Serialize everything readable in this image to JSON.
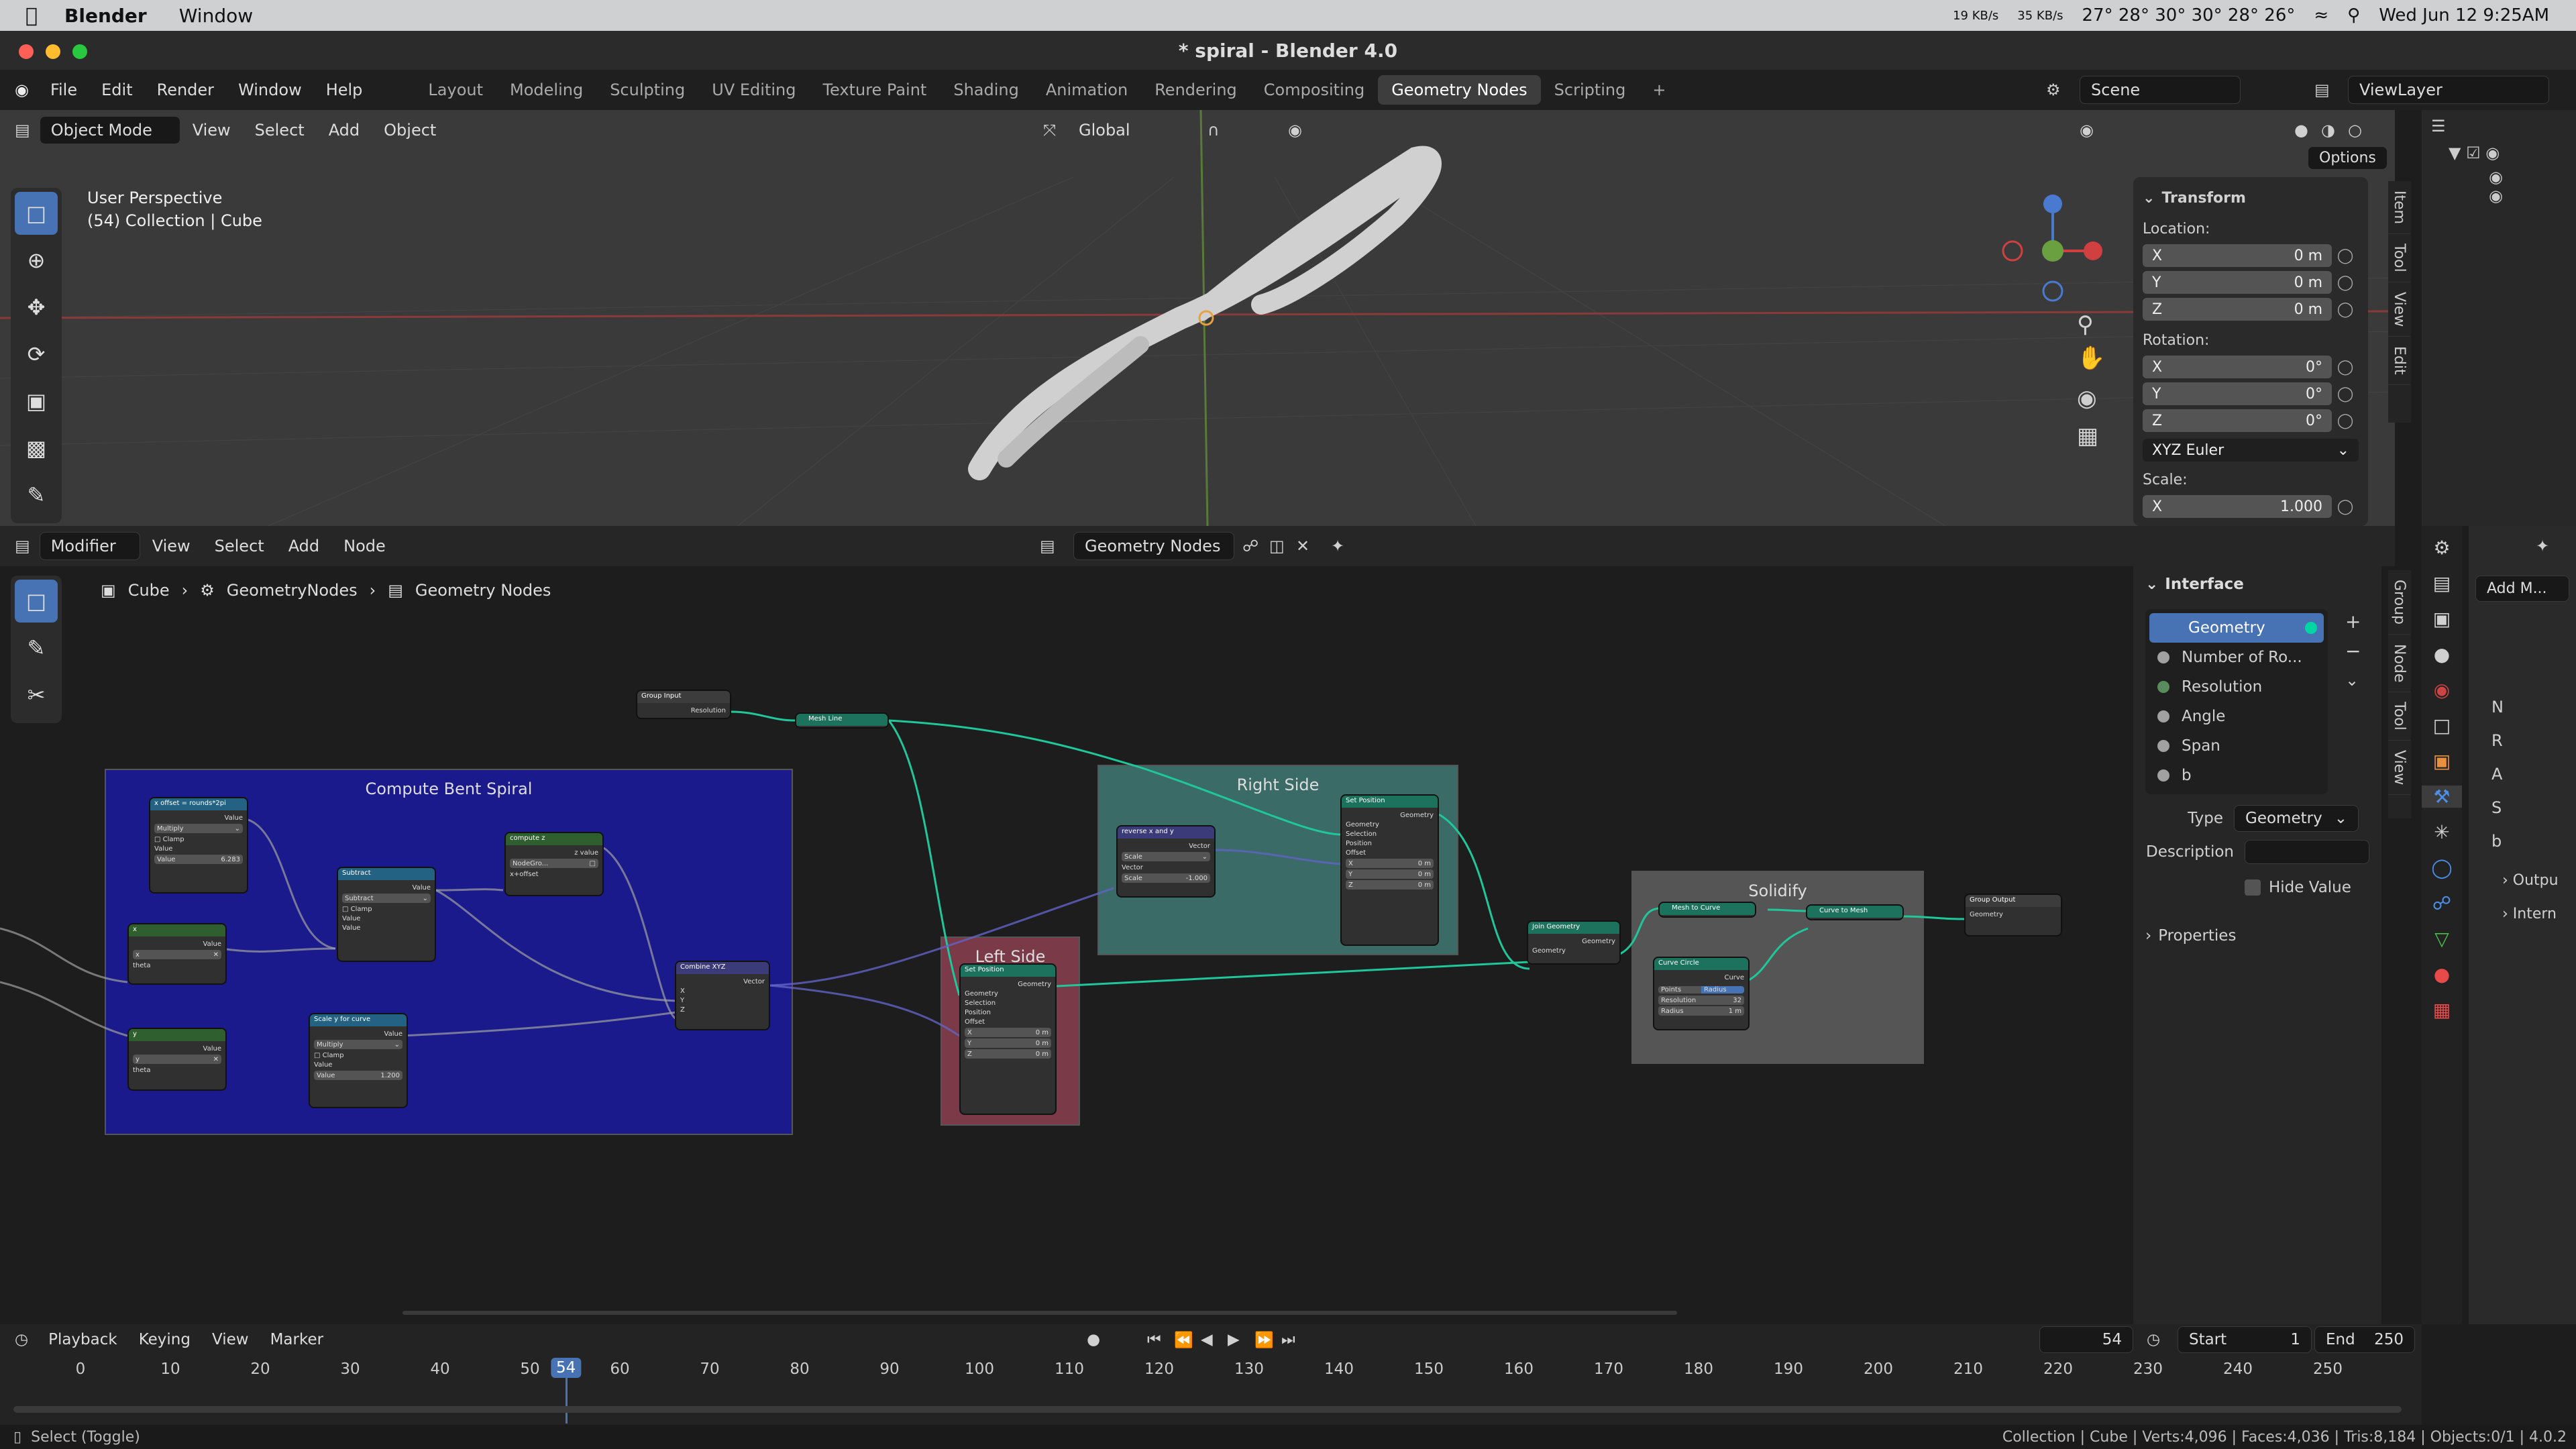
{
  "mac": {
    "app": "Blender",
    "menu": [
      "Window"
    ],
    "net_up": "19 KB/s",
    "net_down": "35 KB/s",
    "temps": "27° 28° 30° 30° 28° 26°",
    "datetime": "Wed Jun 12  9:25AM"
  },
  "window": {
    "title": "* spiral - Blender 4.0"
  },
  "topmenu": [
    "File",
    "Edit",
    "Render",
    "Window",
    "Help"
  ],
  "workspaces": [
    "Layout",
    "Modeling",
    "Sculpting",
    "UV Editing",
    "Texture Paint",
    "Shading",
    "Animation",
    "Rendering",
    "Compositing",
    "Geometry Nodes",
    "Scripting"
  ],
  "active_workspace": "Geometry Nodes",
  "scene": "Scene",
  "viewlayer": "ViewLayer",
  "viewport": {
    "mode": "Object Mode",
    "menus": [
      "View",
      "Select",
      "Add",
      "Object"
    ],
    "transform_orientation": "Global",
    "options_label": "Options",
    "info_line1": "User Perspective",
    "info_line2": "(54) Collection | Cube"
  },
  "npanel": {
    "title": "Transform",
    "location_label": "Location:",
    "location": [
      {
        "axis": "X",
        "value": "0 m"
      },
      {
        "axis": "Y",
        "value": "0 m"
      },
      {
        "axis": "Z",
        "value": "0 m"
      }
    ],
    "rotation_label": "Rotation:",
    "rotation": [
      {
        "axis": "X",
        "value": "0°"
      },
      {
        "axis": "Y",
        "value": "0°"
      },
      {
        "axis": "Z",
        "value": "0°"
      }
    ],
    "rotation_mode": "XYZ Euler",
    "scale_label": "Scale:",
    "scale": [
      {
        "axis": "X",
        "value": "1.000"
      }
    ],
    "tabs": [
      "Item",
      "Tool",
      "View",
      "Edit"
    ]
  },
  "node_editor": {
    "type": "Modifier",
    "menus": [
      "View",
      "Select",
      "Add",
      "Node"
    ],
    "tree_name": "Geometry Nodes",
    "breadcrumb": [
      "Cube",
      "GeometryNodes",
      "Geometry Nodes"
    ],
    "frames": {
      "compute": "Compute Bent Spiral",
      "right": "Right Side",
      "left": "Left Side",
      "solidify": "Solidify"
    },
    "nodes": {
      "group_input": {
        "title": "Group Input",
        "out": "Resolution"
      },
      "mesh_line": {
        "title": "Mesh Line"
      },
      "x_offset": {
        "title": "x offset = rounds*2pi",
        "out": "Value",
        "op": "Multiply",
        "clamp": "Clamp",
        "in1": "Value",
        "in2_label": "Value",
        "in2_val": "6.283"
      },
      "subtract": {
        "title": "Subtract",
        "out": "Value",
        "op": "Subtract",
        "clamp": "Clamp",
        "in1": "Value",
        "in2": "Value"
      },
      "compute_z": {
        "title": "compute z",
        "out": "z value",
        "grp": "NodeGro...",
        "in": "x+offset"
      },
      "x_node": {
        "title": "x",
        "out": "Value",
        "field": "x",
        "in": "theta"
      },
      "y_node": {
        "title": "y",
        "out": "Value",
        "field": "y",
        "in": "theta"
      },
      "scale_y": {
        "title": "Scale y for curve",
        "out": "Value",
        "op": "Multiply",
        "clamp": "Clamp",
        "in1": "Value",
        "in2_label": "Value",
        "in2_val": "1.200"
      },
      "combine": {
        "title": "Combine XYZ",
        "out": "Vector",
        "x": "X",
        "y": "Y",
        "z": "Z"
      },
      "set_pos_left": {
        "title": "Set Position",
        "out": "Geometry",
        "in": [
          "Geometry",
          "Selection",
          "Position",
          "Offset"
        ],
        "x": "X",
        "y": "Y",
        "z": "Z",
        "xv": "0 m",
        "yv": "0 m",
        "zv": "0 m"
      },
      "reverse": {
        "title": "reverse x and y",
        "out": "Vector",
        "op": "Scale",
        "in": "Vector",
        "scale_label": "Scale",
        "scale_val": "-1.000"
      },
      "set_pos_right": {
        "title": "Set Position",
        "out": "Geometry",
        "in": [
          "Geometry",
          "Selection",
          "Position",
          "Offset"
        ],
        "x": "X",
        "y": "Y",
        "z": "Z",
        "xv": "0 m",
        "yv": "0 m",
        "zv": "0 m"
      },
      "join": {
        "title": "Join Geometry",
        "out": "Geometry",
        "in": "Geometry"
      },
      "mesh_to_curve": {
        "title": "Mesh to Curve"
      },
      "curve_to_mesh": {
        "title": "Curve to Mesh"
      },
      "curve_circle": {
        "title": "Curve Circle",
        "out": "Curve",
        "mode1": "Points",
        "mode2": "Radius",
        "res_label": "Resolution",
        "res_val": "32",
        "rad_label": "Radius",
        "rad_val": "1 m"
      },
      "group_output": {
        "title": "Group Output",
        "in": "Geometry"
      }
    }
  },
  "interface": {
    "title": "Interface",
    "items": [
      {
        "label": "Geometry",
        "color": "#00d6a3"
      },
      {
        "label": "Number of Ro...",
        "color": "#a1a1a1"
      },
      {
        "label": "Resolution",
        "color": "#598c5c"
      },
      {
        "label": "Angle",
        "color": "#a1a1a1"
      },
      {
        "label": "Span",
        "color": "#a1a1a1"
      },
      {
        "label": "b",
        "color": "#a1a1a1"
      }
    ],
    "type_label": "Type",
    "type_value": "Geometry",
    "description_label": "Description",
    "hide_value": "Hide Value",
    "properties": "Properties",
    "tabs": [
      "Group",
      "Node",
      "Tool",
      "View"
    ]
  },
  "modifier_panel": {
    "add_modifier": "Add M...",
    "letters": [
      "N",
      "R",
      "A",
      "S",
      "b"
    ],
    "output": "Outpu",
    "internal": "Intern"
  },
  "timeline": {
    "menus": [
      "Playback",
      "Keying",
      "View",
      "Marker"
    ],
    "current_frame": "54",
    "start_label": "Start",
    "start": "1",
    "end_label": "End",
    "end": "250",
    "ticks": [
      "0",
      "10",
      "20",
      "30",
      "40",
      "50",
      "60",
      "70",
      "80",
      "90",
      "100",
      "110",
      "120",
      "130",
      "140",
      "150",
      "160",
      "170",
      "180",
      "190",
      "200",
      "210",
      "220",
      "230",
      "240",
      "250"
    ]
  },
  "status": {
    "hint": "Select (Toggle)",
    "stats": "Collection | Cube | Verts:4,096 | Faces:4,036 | Tris:8,184 | Objects:0/1 | 4.0.2"
  },
  "colors": {
    "accent": "#4772b3",
    "frame_blue": "#1a1a8c",
    "frame_teal": "#3a6b66",
    "frame_red": "#7a3a48",
    "frame_gray": "#555555",
    "node_geometry_header": "#1d725e",
    "node_math_header": "#246283",
    "socket_geometry": "#00d6a3",
    "socket_float": "#a1a1a1",
    "socket_vector": "#6363c7",
    "link": "#1fc79a"
  }
}
